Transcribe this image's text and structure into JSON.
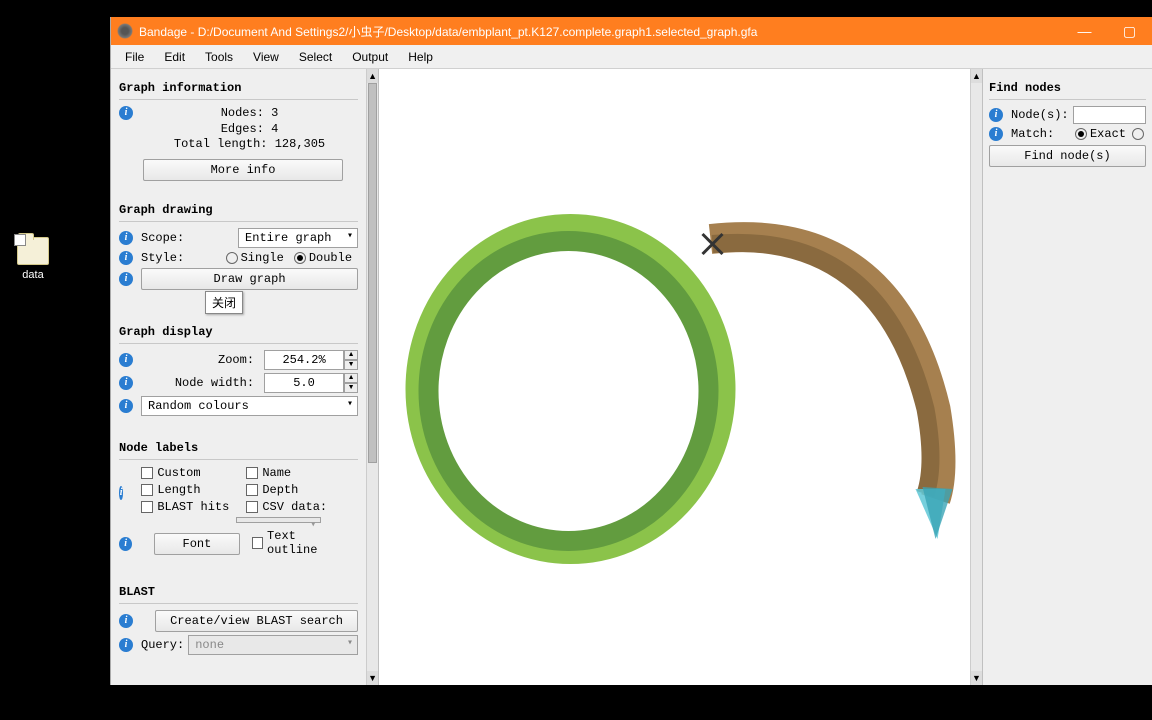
{
  "desktop": {
    "folder_label": "data"
  },
  "titlebar": {
    "title": "Bandage - D:/Document And Settings2/小虫子/Desktop/data/embplant_pt.K127.complete.graph1.selected_graph.gfa",
    "min": "—",
    "max": "▢",
    "close": "✕"
  },
  "menubar": [
    "File",
    "Edit",
    "Tools",
    "View",
    "Select",
    "Output",
    "Help"
  ],
  "sidebar": {
    "graph_info_title": "Graph information",
    "nodes_label": "Nodes:",
    "nodes_val": "3",
    "edges_label": "Edges:",
    "edges_val": "4",
    "total_label": "Total length:",
    "total_val": "128,305",
    "more_info": "More info",
    "graph_drawing_title": "Graph drawing",
    "scope_label": "Scope:",
    "scope_value": "Entire graph",
    "style_label": "Style:",
    "style_single": "Single",
    "style_double": "Double",
    "draw_graph": "Draw graph",
    "tooltip_close": "关闭",
    "graph_display_title": "Graph display",
    "zoom_label": "Zoom:",
    "zoom_val": "254.2%",
    "node_width_label": "Node width:",
    "node_width_val": "5.0",
    "colour_mode": "Random colours",
    "node_labels_title": "Node labels",
    "chk_custom": "Custom",
    "chk_name": "Name",
    "chk_length": "Length",
    "chk_depth": "Depth",
    "chk_blast": "BLAST hits",
    "chk_csv": "CSV data:",
    "font_btn": "Font",
    "text_outline": "Text outline",
    "blast_title": "BLAST",
    "blast_create": "Create/view BLAST search",
    "query_label": "Query:",
    "query_val": "none"
  },
  "right": {
    "title": "Find nodes",
    "nodes_label": "Node(s):",
    "match_label": "Match:",
    "exact": "Exact",
    "find_btn": "Find node(s)"
  }
}
